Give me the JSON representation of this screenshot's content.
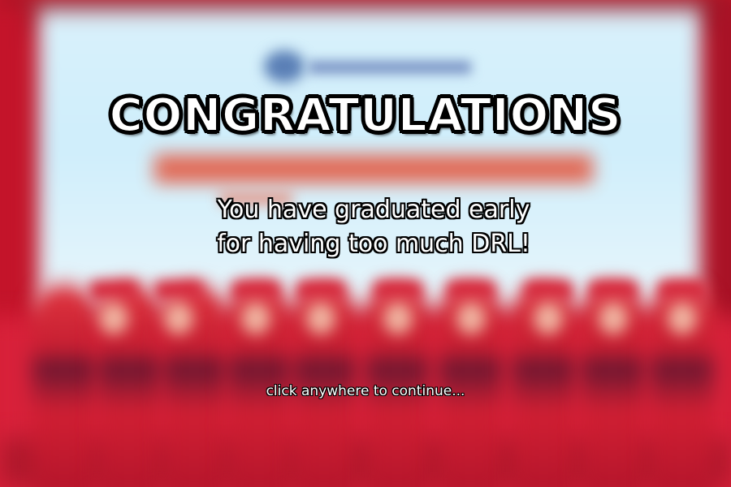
{
  "screen": {
    "title": "CONGRATULATIONS",
    "message_line_1": "You have graduated early",
    "message_line_2": "for having too much DRL!",
    "hint": "click anywhere to continue..."
  },
  "background": {
    "description_icon": "blurred-graduation-ceremony-photo",
    "colors": {
      "screen": "#d9f1fb",
      "robes": "#d11f33",
      "curtain": "#c3142a"
    }
  }
}
